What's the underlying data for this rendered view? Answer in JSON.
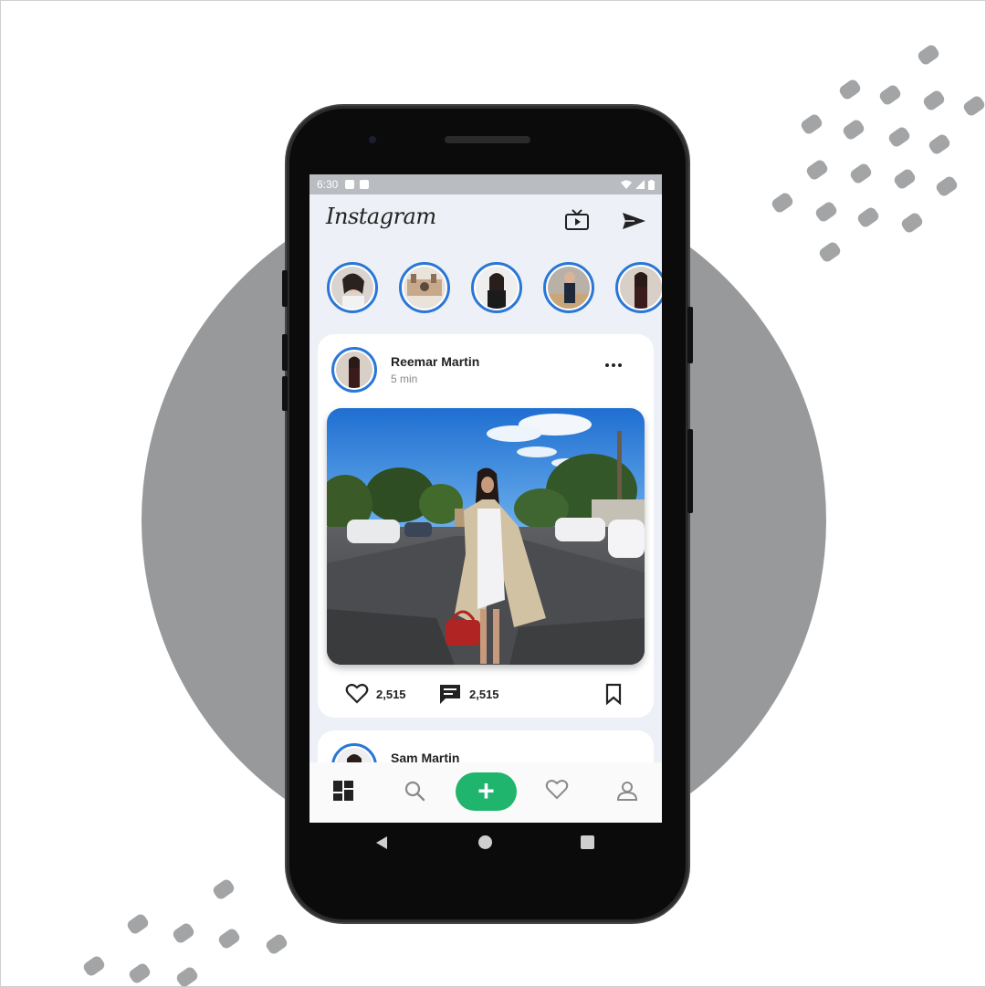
{
  "status_bar": {
    "time": "6:30"
  },
  "app": {
    "logo_text": "Instagram"
  },
  "icons": {
    "tv": "tv-icon",
    "send": "send-icon",
    "like": "heart-icon",
    "comment": "comment-icon",
    "bookmark": "bookmark-icon",
    "home": "grid-home-icon",
    "search": "search-icon",
    "add": "plus-icon",
    "activity": "heart-icon",
    "profile": "person-icon"
  },
  "stories": [
    {
      "name": "story-1"
    },
    {
      "name": "story-2"
    },
    {
      "name": "story-3"
    },
    {
      "name": "story-4"
    },
    {
      "name": "story-5"
    }
  ],
  "posts": [
    {
      "author": "Reemar Martin",
      "time": "5 min",
      "likes": "2,515",
      "comments": "2,515"
    },
    {
      "author": "Sam Martin"
    }
  ],
  "nav": {
    "add_label": "+"
  },
  "colors": {
    "accent_blue": "#2a77d6",
    "add_green": "#1fb56d",
    "background_circle": "#98999b"
  }
}
